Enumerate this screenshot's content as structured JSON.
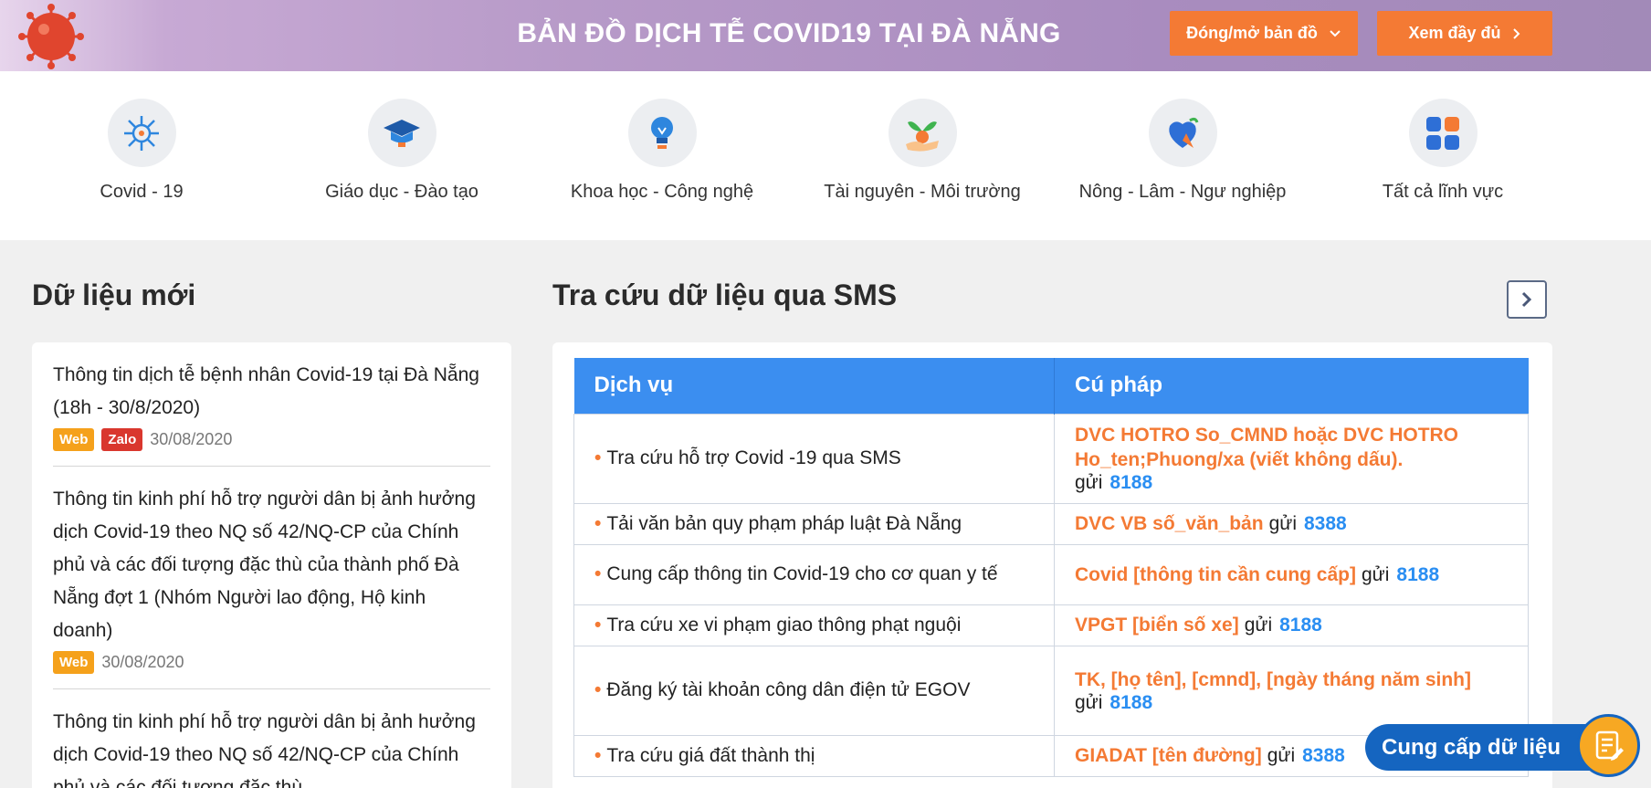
{
  "banner": {
    "title": "BẢN ĐỒ DỊCH TỄ COVID19 TẠI ĐÀ NẴNG",
    "toggle_map_label": "Đóng/mở bản đồ",
    "view_full_label": "Xem đầy đủ"
  },
  "categories": [
    {
      "label": "Covid - 19",
      "icon": "virus-icon"
    },
    {
      "label": "Giáo dục - Đào tạo",
      "icon": "graduation-cap-icon"
    },
    {
      "label": "Khoa học - Công nghệ",
      "icon": "lightbulb-icon"
    },
    {
      "label": "Tài nguyên - Môi trường",
      "icon": "plant-hand-icon"
    },
    {
      "label": "Nông - Lâm - Ngư nghiệp",
      "icon": "agriculture-icon"
    },
    {
      "label": "Tất cả lĩnh vực",
      "icon": "grid-apps-icon"
    }
  ],
  "news": {
    "heading": "Dữ liệu mới",
    "items": [
      {
        "title": "Thông tin dịch tễ bệnh nhân Covid-19 tại Đà Nẵng (18h - 30/8/2020)",
        "tags": [
          "Web",
          "Zalo"
        ],
        "date": "30/08/2020"
      },
      {
        "title": "Thông tin kinh phí hỗ trợ người dân bị ảnh hưởng dịch Covid-19 theo NQ số 42/NQ-CP của Chính phủ và các đối tượng đặc thù của thành phố Đà Nẵng đợt 1 (Nhóm Người lao động, Hộ kinh doanh)",
        "tags": [
          "Web"
        ],
        "date": "30/08/2020"
      },
      {
        "title": "Thông tin kinh phí hỗ trợ người dân bị ảnh hưởng dịch Covid-19 theo NQ số 42/NQ-CP của Chính phủ và các đối tượng đặc thù",
        "tags": [],
        "date": ""
      }
    ]
  },
  "sms": {
    "heading": "Tra cứu dữ liệu qua SMS",
    "col_service": "Dịch vụ",
    "col_syntax": "Cú pháp",
    "send_word": "gửi",
    "rows": [
      {
        "service": "Tra cứu hỗ trợ Covid -19 qua SMS",
        "syntax": "DVC HOTRO So_CMND hoặc DVC HOTRO Ho_ten;Phuong/xa (viết không dấu).",
        "number": "8188",
        "break": true
      },
      {
        "service": "Tải văn bản quy phạm pháp luật Đà Nẵng",
        "syntax": "DVC VB số_văn_bản",
        "number": "8388",
        "break": false
      },
      {
        "service": "Cung cấp thông tin Covid-19 cho cơ quan y tế",
        "syntax": "Covid [thông tin cần cung cấp]",
        "number": "8188",
        "break": false
      },
      {
        "service": "Tra cứu xe vi phạm giao thông phạt nguội",
        "syntax": "VPGT [biển số xe]",
        "number": "8188",
        "break": false
      },
      {
        "service": "Đăng ký tài khoản công dân điện tử EGOV",
        "syntax": "TK, [họ tên], [cmnd], [ngày tháng năm sinh]",
        "number": "8188",
        "break": true
      },
      {
        "service": "Tra cứu giá đất thành thị",
        "syntax": "GIADAT [tên đường]",
        "number": "8388",
        "break": false
      }
    ]
  },
  "provide_button": {
    "label": "Cung cấp dữ liệu"
  },
  "colors": {
    "accent_orange": "#f47a34",
    "table_header_blue": "#3b8ef0",
    "banner_purple": "#a98cbf"
  }
}
